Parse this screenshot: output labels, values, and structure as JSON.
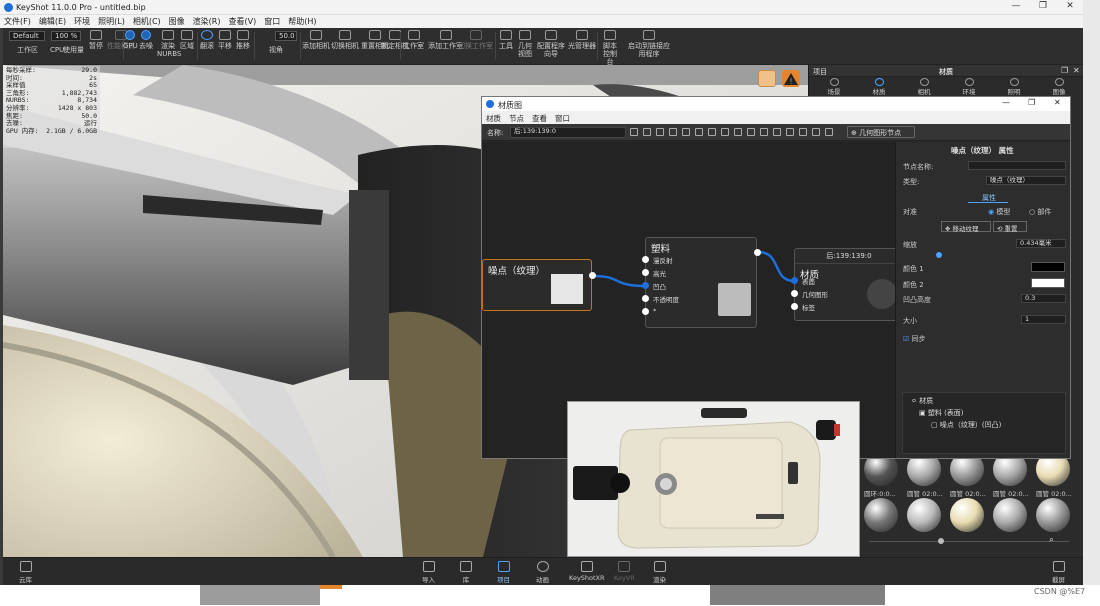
{
  "app": {
    "title": "KeyShot 11.0.0 Pro  - untitled.bip",
    "win_controls": [
      "—",
      "❐",
      "✕"
    ]
  },
  "menu": [
    "文件(F)",
    "编辑(E)",
    "环境",
    "照明(L)",
    "相机(C)",
    "图像",
    "渲染(R)",
    "查看(V)",
    "窗口",
    "帮助(H)"
  ],
  "toolbar": {
    "preset": "Default",
    "zoom": "100 %",
    "fov": "50.0",
    "items": [
      "工作区",
      "CPU",
      "使用量",
      "暂停",
      "性能模式",
      "GPU",
      "去噪",
      "渲染NURBS",
      "区域",
      "翻滚",
      "平移",
      "推移",
      "视角",
      "添加相机",
      "切换相机",
      "重置相机",
      "锁定相机",
      "工作室",
      "添加工作室",
      "切换工作室",
      "工具",
      "几何视图",
      "配置程序向导",
      "光管理器",
      "脚本控制台",
      "启动到链接应用程序"
    ]
  },
  "stats": [
    [
      "每秒采样:",
      "29.0"
    ],
    [
      "时间:",
      "2s"
    ],
    [
      "采样值",
      "65"
    ],
    [
      "三角形:",
      "1,882,743"
    ],
    [
      "NURBS:",
      "8,734"
    ],
    [
      "分辨率:",
      "1428 x 803"
    ],
    [
      "焦距:",
      "50.0"
    ],
    [
      "去噪:",
      "运行"
    ],
    [
      "GPU 内存:",
      "2.1GB / 6.0GB"
    ]
  ],
  "rpanel": {
    "left_title": "项目",
    "title": "材质",
    "tabs": [
      "场景",
      "材质",
      "相机",
      "环境",
      "照明",
      "图像"
    ],
    "swatch_labels": [
      "圆环:0:0...",
      "圆管 02:0...",
      "圆管 02:0...",
      "圆管 02:0...",
      "圆管 02:0..."
    ]
  },
  "mg": {
    "title": "材质图",
    "menu": [
      "材质",
      "节点",
      "查看",
      "窗口"
    ],
    "name_label": "名称:",
    "name_value": "后:139:139:0",
    "geo_btn": "几何图形节点",
    "nodes": {
      "noise": {
        "title": "噪点（纹理）"
      },
      "plastic": {
        "title": "塑料",
        "ports": [
          "漫反射",
          "高光",
          "凹凸",
          "不透明度",
          "*"
        ]
      },
      "material": {
        "header": "后:139:139:0",
        "title": "材质",
        "ports": [
          "表面",
          "几何图形",
          "标签"
        ]
      }
    },
    "props": {
      "title": "噪点（纹理） 属性",
      "node_name_label": "节点名称:",
      "type_label": "类型:",
      "type_value": "噪点（纹理）",
      "tab": "属性",
      "align_label": "对准",
      "mode_model": "模型",
      "mode_part": "部件",
      "move_btn": "移动纹理",
      "reset_btn": "重置",
      "scale_label": "缩放",
      "scale_value": "0.434毫米",
      "color1_label": "颜色 1",
      "color2_label": "颜色 2",
      "bump_label": "凹凸高度",
      "bump_value": "0.3",
      "size_label": "大小",
      "size_value": "1",
      "sync_label": "同步",
      "tree": [
        "材质",
        "塑料 (表面)",
        "噪点（纹理）(凹凸)"
      ]
    }
  },
  "bottom": [
    "云库",
    "导入",
    "库",
    "项目",
    "动画",
    "KeyShotXR",
    "KeyVR",
    "渲染",
    "截屏"
  ],
  "watermark": "CSDN @%E7"
}
